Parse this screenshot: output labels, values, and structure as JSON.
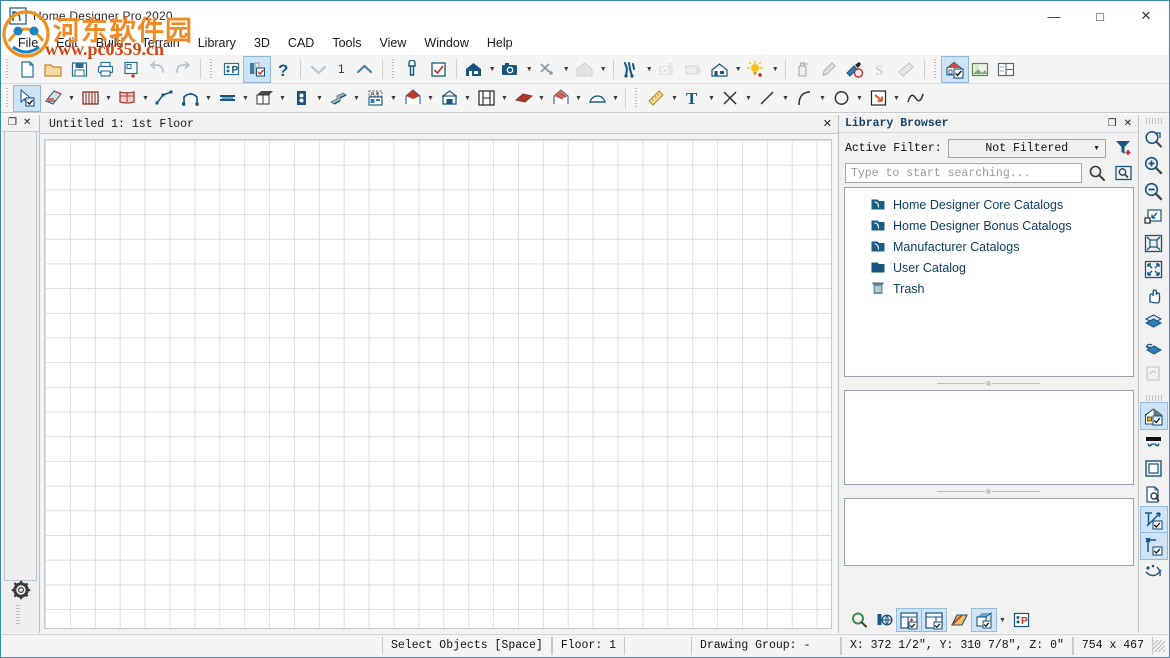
{
  "window": {
    "title": "Home Designer Pro 2020",
    "app_icon": "home-designer-logo-icon",
    "minimize": "—",
    "maximize": "□",
    "close": "✕"
  },
  "watermark": {
    "chinese": "河东软件园",
    "url": "www.pc0359.cn"
  },
  "menubar": {
    "items": [
      {
        "label": "File"
      },
      {
        "label": "Edit"
      },
      {
        "label": "Build"
      },
      {
        "label": "Terrain"
      },
      {
        "label": "Library"
      },
      {
        "label": "3D"
      },
      {
        "label": "CAD"
      },
      {
        "label": "Tools"
      },
      {
        "label": "View"
      },
      {
        "label": "Window"
      },
      {
        "label": "Help"
      }
    ]
  },
  "toolbar_top": {
    "floor_number": "1",
    "buttons": [
      {
        "name": "new-plan",
        "title": "New Plan"
      },
      {
        "name": "open-plan",
        "title": "Open Plan"
      },
      {
        "name": "save-plan",
        "title": "Save Plan"
      },
      {
        "name": "print-plan",
        "title": "Print"
      },
      {
        "name": "plan-footprint",
        "title": "Print Preview"
      },
      {
        "name": "undo",
        "title": "Undo"
      },
      {
        "name": "redo",
        "title": "Redo"
      },
      {
        "name": "preferences",
        "title": "Preferences"
      },
      {
        "name": "default-settings",
        "title": "Default Settings"
      },
      {
        "name": "help",
        "title": "Help"
      },
      {
        "name": "down-floor",
        "title": "Down One Floor"
      },
      {
        "name": "up-floor",
        "title": "Up One Floor"
      },
      {
        "name": "adjust-material-definition",
        "title": "Adjust Material Definition"
      },
      {
        "name": "display-options",
        "title": "Display Options"
      },
      {
        "name": "full-camera",
        "title": "Full Camera"
      },
      {
        "name": "perspective-camera",
        "title": "Perspective Camera"
      },
      {
        "name": "cross-section",
        "title": "Cross Section / Elevation"
      },
      {
        "name": "doll-house-view",
        "title": "Doll House View"
      },
      {
        "name": "walkthrough",
        "title": "Record Walkthrough"
      },
      {
        "name": "orthographic-camera",
        "title": "Orthographic Camera"
      },
      {
        "name": "elevation-camera",
        "title": "Elevation Camera"
      },
      {
        "name": "overview",
        "title": "Overview"
      },
      {
        "name": "add-light",
        "title": "Adjust Lighting"
      },
      {
        "name": "material-sprayer",
        "title": "Material Sprayer"
      },
      {
        "name": "material-eyedropper",
        "title": "Material Eyedropper"
      },
      {
        "name": "material-painter",
        "title": "Material Painter"
      },
      {
        "name": "suspend-snaps",
        "title": "Suspend Snaps"
      },
      {
        "name": "measure-tool",
        "title": "Measure"
      },
      {
        "name": "material-painter-mode",
        "title": "Material Painter Mode"
      },
      {
        "name": "plan-view",
        "title": "Plan View"
      },
      {
        "name": "layout-view",
        "title": "Layout"
      }
    ]
  },
  "toolbar_second": {
    "buttons": [
      {
        "name": "select-objects",
        "title": "Select Objects",
        "active": true
      },
      {
        "name": "wall-tools",
        "title": "Wall Tools"
      },
      {
        "name": "railing-tools",
        "title": "Railing and Deck Tools"
      },
      {
        "name": "room-tools",
        "title": "Room Tools"
      },
      {
        "name": "polyline-tools",
        "title": "Polyline Tools"
      },
      {
        "name": "arch-tools",
        "title": "Arch Tools"
      },
      {
        "name": "beam-tools",
        "title": "Beam Tools"
      },
      {
        "name": "cabinet-tools",
        "title": "Cabinet Tools"
      },
      {
        "name": "window-tools",
        "title": "Window Tools"
      },
      {
        "name": "stair-tools",
        "title": "Stair Tools"
      },
      {
        "name": "door-tools",
        "title": "Door Tools"
      },
      {
        "name": "roof-tools",
        "title": "Roof Tools"
      },
      {
        "name": "fireplace-tools",
        "title": "Fireplace Tools"
      },
      {
        "name": "framing-tools",
        "title": "Framing Tools"
      },
      {
        "name": "deck-tools",
        "title": "Deck Tools"
      },
      {
        "name": "roof-plane-tools",
        "title": "Roof Plane Tools"
      },
      {
        "name": "foundation-tools",
        "title": "Foundation Tools"
      },
      {
        "name": "dimension-tools",
        "title": "Dimension Tools"
      },
      {
        "name": "text-tools",
        "title": "Text Tools"
      },
      {
        "name": "point-tools",
        "title": "CAD Point"
      },
      {
        "name": "line-tools",
        "title": "CAD Line"
      },
      {
        "name": "arc-tools",
        "title": "CAD Arc"
      },
      {
        "name": "circle-tools",
        "title": "CAD Circle"
      },
      {
        "name": "box-tools",
        "title": "CAD Box"
      },
      {
        "name": "spline-tools",
        "title": "CAD Spline"
      }
    ]
  },
  "left_dock": {
    "restore_icon": "❐",
    "close_icon": "✕",
    "gear_icon": "gear-icon"
  },
  "document": {
    "tab_label": "Untitled 1: 1st Floor",
    "close_icon": "✕"
  },
  "library": {
    "title": "Library Browser",
    "restore_icon": "❐",
    "close_icon": "✕",
    "filter_label": "Active Filter:",
    "filter_value": "Not Filtered",
    "filter_arrow": "▼",
    "search_placeholder": "Type to start searching...",
    "search_icon": "search-icon",
    "browse_icon": "browse-folder-icon",
    "add-filter_icon": "add-filter-icon",
    "tree": [
      {
        "label": "Home Designer Core Catalogs",
        "icon": "catalog-folder-icon"
      },
      {
        "label": "Home Designer Bonus Catalogs",
        "icon": "catalog-folder-icon"
      },
      {
        "label": "Manufacturer Catalogs",
        "icon": "catalog-folder-icon"
      },
      {
        "label": "User Catalog",
        "icon": "user-folder-icon"
      },
      {
        "label": "Trash",
        "icon": "trash-icon"
      }
    ],
    "bottom_buttons": [
      {
        "name": "library-search",
        "title": "Library Search"
      },
      {
        "name": "get-additional-content",
        "title": "Get Additional Content Online"
      },
      {
        "name": "show-panel-a",
        "title": "Toggle Preview Panel"
      },
      {
        "name": "show-panel-b",
        "title": "Toggle Selection Panel"
      },
      {
        "name": "hide-texture",
        "title": "Hide Texture"
      },
      {
        "name": "3d-preview",
        "title": "3D Preview"
      },
      {
        "name": "library-preferences",
        "title": "Preferences"
      }
    ]
  },
  "right_rail": {
    "buttons": [
      {
        "name": "zoom-window",
        "title": "Zoom Window"
      },
      {
        "name": "zoom-in",
        "title": "Zoom In"
      },
      {
        "name": "zoom-out",
        "title": "Zoom Out"
      },
      {
        "name": "fill-window",
        "title": "Fill Window"
      },
      {
        "name": "fill-window-building-only",
        "title": "Fill Window Building Only"
      },
      {
        "name": "zoom-extents",
        "title": "Zoom Extents"
      },
      {
        "name": "pan-window",
        "title": "Pan Window"
      },
      {
        "name": "up-one-floor",
        "title": "Up One Floor"
      },
      {
        "name": "down-one-floor",
        "title": "Down One Floor"
      },
      {
        "name": "undo-zoom",
        "title": "Undo Zoom"
      },
      {
        "name": "reference-display",
        "title": "Reference Display"
      },
      {
        "name": "refresh-display",
        "title": "Refresh Display"
      },
      {
        "name": "color-toggle",
        "title": "Color On/Off"
      },
      {
        "name": "print-preview",
        "title": "Print Preview"
      },
      {
        "name": "temporary-dimensions",
        "title": "Temporary Dimensions"
      },
      {
        "name": "angle-snaps",
        "title": "Angle Snaps"
      },
      {
        "name": "object-snaps",
        "title": "Object Snaps"
      }
    ]
  },
  "statusbar": {
    "tool_status": "Select Objects [Space]",
    "floor": "Floor: 1",
    "drawing_group": "Drawing Group: -",
    "coordinates": "X: 372 1/2″, Y: 310 7/8″, Z: 0″",
    "canvas_size": "754 x 467"
  },
  "colors": {
    "accent_blue": "#17567f",
    "window_border": "#3a8aa8",
    "highlight": "#cde4f7",
    "watermark_orange": "#f08a24",
    "watermark_red": "#d8430f"
  }
}
